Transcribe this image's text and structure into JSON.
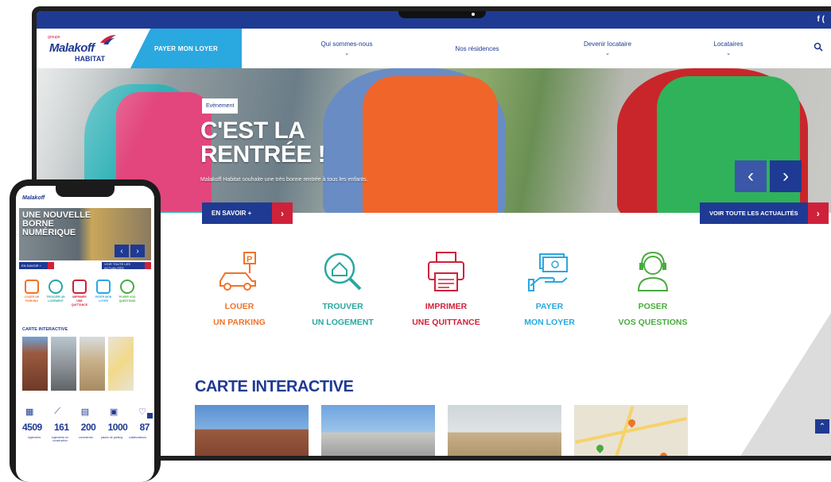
{
  "brand": {
    "group": "groupe",
    "name": "Malakoff",
    "sub": "HABITAT",
    "colors": {
      "navy": "#1f3a93",
      "sky": "#2aa8e0",
      "red": "#d0213b"
    }
  },
  "topbar": {
    "social_icons": [
      "facebook-icon",
      "other-social-icon"
    ],
    "social_text": "f ("
  },
  "nav": {
    "cta": "PAYER MON LOYER",
    "items": [
      {
        "label": "Qui sommes-nous"
      },
      {
        "label": "Nos résidences"
      },
      {
        "label": "Devenir locataire"
      },
      {
        "label": "Locataires"
      }
    ],
    "search_icon": "search-icon"
  },
  "hero": {
    "badge": "Evènement",
    "title_line1": "C'EST LA",
    "title_line2": "RENTRÉE  !",
    "subtitle": "Malakoff Habitat souhaite une très bonne rentrée à tous les enfants.",
    "cta": "EN SAVOIR +",
    "all_news": "VOIR TOUTE LES ACTUALITÉS"
  },
  "services": [
    {
      "line1": "LOUER",
      "line2": "UN PARKING",
      "color": "#f0732a",
      "icon": "parking-car-icon"
    },
    {
      "line1": "TROUVER",
      "line2": "UN LOGEMENT",
      "color": "#2aa7a0",
      "icon": "house-search-icon"
    },
    {
      "line1": "IMPRIMER",
      "line2": "UNE QUITTANCE",
      "color": "#d0213b",
      "icon": "printer-icon"
    },
    {
      "line1": "PAYER",
      "line2": "MON LOYER",
      "color": "#2aa8e0",
      "icon": "pay-hand-icon"
    },
    {
      "line1": "POSER",
      "line2": "VOS QUESTIONS",
      "color": "#4aab3e",
      "icon": "headset-icon"
    }
  ],
  "carte": {
    "title": "CARTE INTERACTIVE"
  },
  "mobile": {
    "logo": "Malakoff",
    "hero_title_1": "UNE NOUVELLE",
    "hero_title_2": "BORNE",
    "hero_title_3": "NUMÉRIQUE",
    "btn_more": "EN SAVOIR +",
    "btn_all": "VOIR TOUTE LES ACTUALITÉS",
    "carte_title": "CARTE INTERACTIVE",
    "service_labels": [
      "LOUER UN PARKING",
      "TROUVER UN LOGEMENT",
      "IMPRIMER UNE QUITTANCE",
      "PAYER MON LOYER",
      "POSER VOS QUESTIONS"
    ],
    "stats": [
      {
        "value": "4509",
        "label": "logements"
      },
      {
        "value": "161",
        "label": "logements en construction"
      },
      {
        "value": "200",
        "label": "commerces"
      },
      {
        "value": "1000",
        "label": "places de parking"
      },
      {
        "value": "87",
        "label": "collaborateurs"
      }
    ]
  }
}
